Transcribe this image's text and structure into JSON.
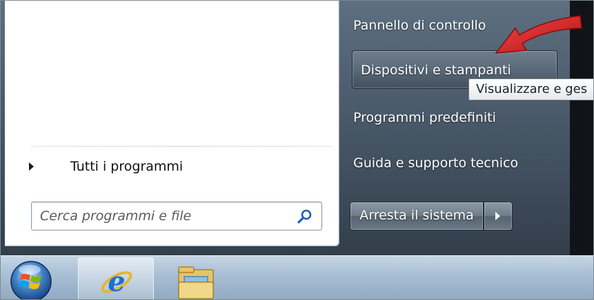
{
  "start_menu": {
    "all_programs_label": "Tutti i programmi",
    "search": {
      "placeholder": "Cerca programmi e file",
      "value": ""
    },
    "right_items": [
      {
        "label": "Pannello di controllo"
      },
      {
        "label": "Dispositivi e stampanti",
        "highlighted": true
      },
      {
        "label": "Programmi predefiniti"
      },
      {
        "label": "Guida e supporto tecnico"
      }
    ],
    "shutdown_label": "Arresta il sistema",
    "tooltip": "Visualizzare e ges"
  },
  "taskbar": {
    "pinned": [
      "start-orb",
      "internet-explorer-icon",
      "windows-explorer-icon"
    ]
  },
  "colors": {
    "annotation_arrow": "#d41c1c",
    "search_icon": "#1f5fb5"
  }
}
